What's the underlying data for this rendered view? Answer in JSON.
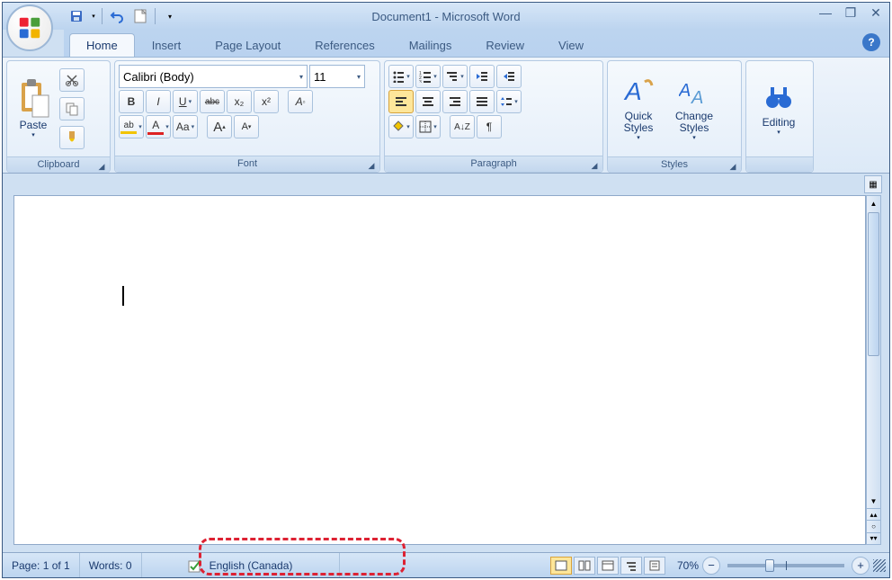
{
  "title": "Document1 - Microsoft Word",
  "qat": {
    "save": "save-icon",
    "undo": "undo-icon",
    "redo": "redo-icon",
    "new": "new-doc-icon"
  },
  "tabs": [
    "Home",
    "Insert",
    "Page Layout",
    "References",
    "Mailings",
    "Review",
    "View"
  ],
  "active_tab": 0,
  "ribbon": {
    "clipboard": {
      "label": "Clipboard",
      "paste": "Paste"
    },
    "font": {
      "label": "Font",
      "family": "Calibri (Body)",
      "size": "11",
      "bold": "B",
      "italic": "I",
      "underline": "U",
      "strike": "abc",
      "sub": "x₂",
      "sup": "x²",
      "highlight": "ab",
      "color": "A",
      "case": "Aa",
      "grow": "A",
      "shrink": "A",
      "clear": "A"
    },
    "paragraph": {
      "label": "Paragraph",
      "sort": "A↓Z",
      "pilcrow": "¶"
    },
    "styles": {
      "label": "Styles",
      "quick": "Quick Styles",
      "change": "Change Styles"
    },
    "editing": {
      "label": "Editing",
      "find": "Editing"
    }
  },
  "status": {
    "page": "Page: 1 of 1",
    "words": "Words: 0",
    "language": "English (Canada)",
    "zoom": "70%"
  }
}
